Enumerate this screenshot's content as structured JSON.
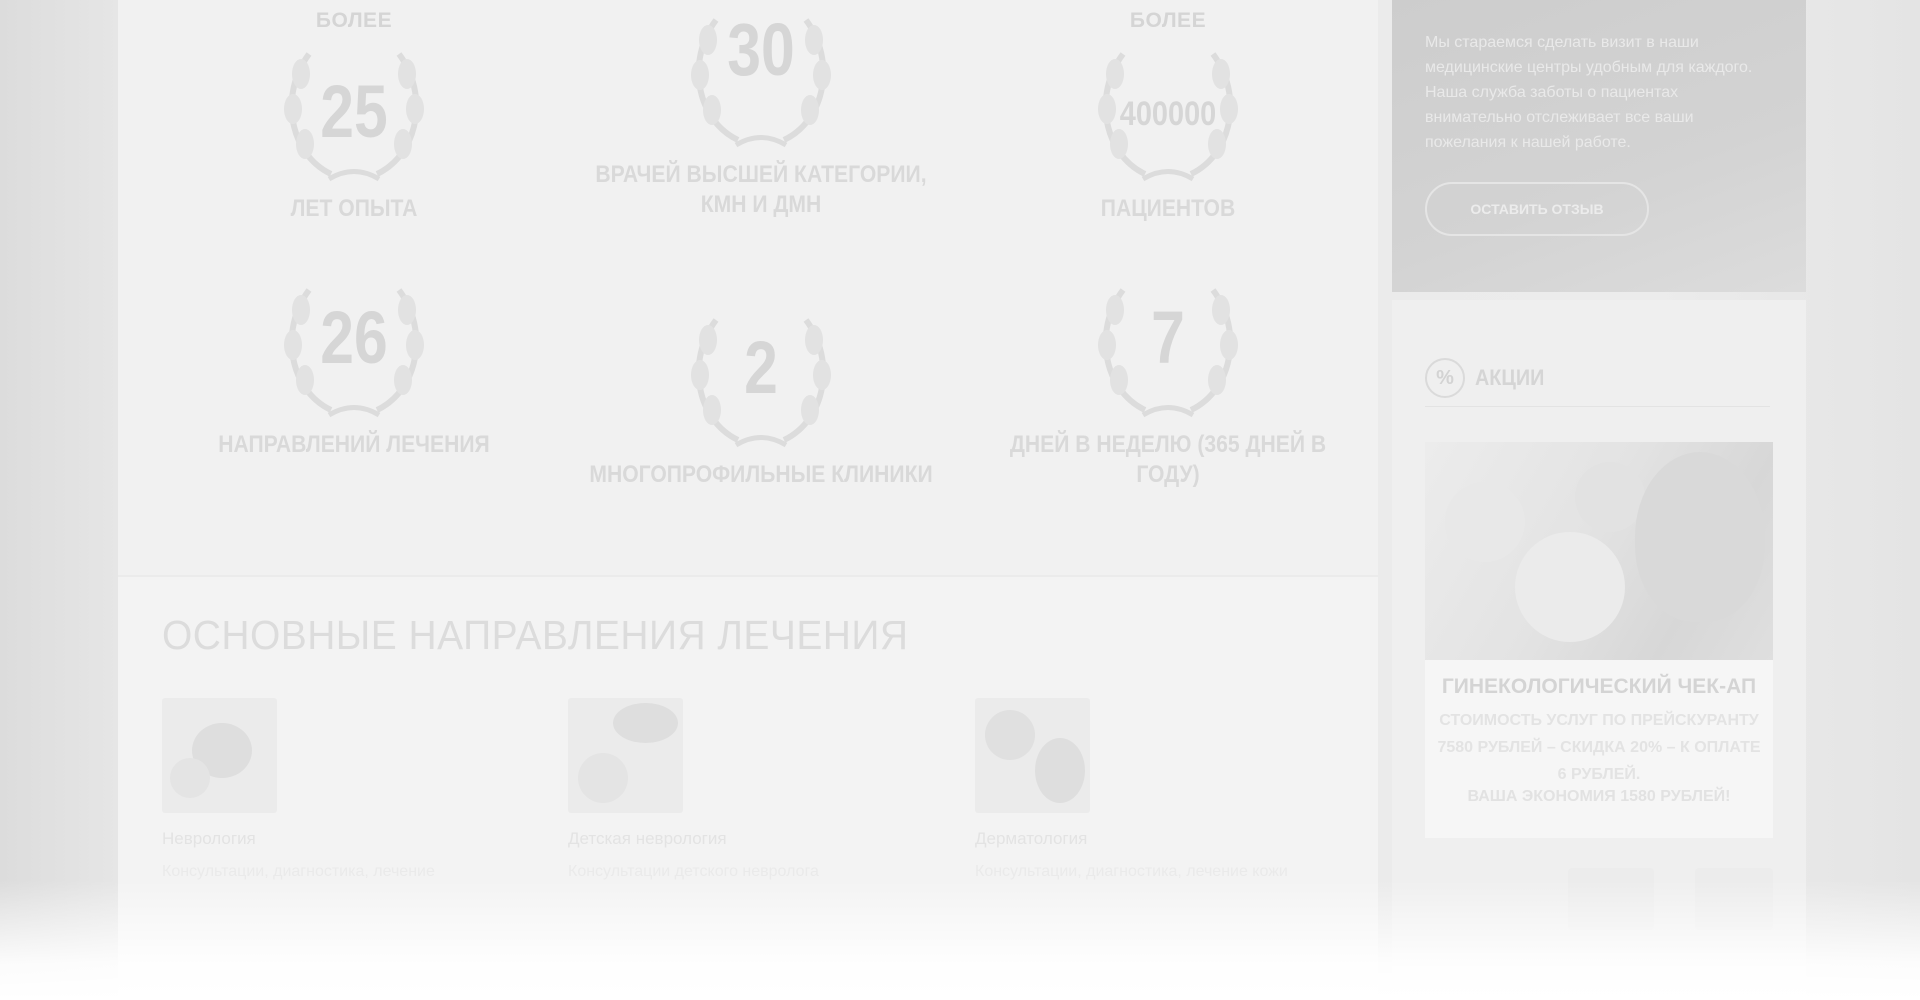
{
  "stats": [
    {
      "prefix": "БОЛЕЕ",
      "number": "25",
      "label": "ЛЕТ ОПЫТА"
    },
    {
      "prefix": "",
      "number": "30",
      "label": "ВРАЧЕЙ ВЫСШЕЙ КАТЕГОРИИ, КМН И ДМН"
    },
    {
      "prefix": "БОЛЕЕ",
      "number": "400000",
      "label": "ПАЦИЕНТОВ"
    },
    {
      "prefix": "",
      "number": "26",
      "label": "НАПРАВЛЕНИЙ ЛЕЧЕНИЯ"
    },
    {
      "prefix": "",
      "number": "2",
      "label": "МНОГОПРОФИЛЬНЫЕ КЛИНИКИ"
    },
    {
      "prefix": "",
      "number": "7",
      "label": "ДНЕЙ В НЕДЕЛЮ (365 ДНЕЙ В ГОДУ)"
    }
  ],
  "directions": {
    "title": "ОСНОВНЫЕ НАПРАВЛЕНИЯ ЛЕЧЕНИЯ",
    "items": [
      {
        "name": "Неврология",
        "desc": "Консультации, диагностика, лечение"
      },
      {
        "name": "Детская неврология",
        "desc": "Консультации детского невролога"
      },
      {
        "name": "Дерматология",
        "desc": "Консультации, диагностика, лечение кожи"
      }
    ]
  },
  "sidebar": {
    "feedback_text": "Мы стараемся сделать визит в наши медицинские центры удобным для каждого. Наша служба заботы о пациентах внимательно отслеживает все ваши пожелания к нашей работе.",
    "feedback_button": "ОСТАВИТЬ ОТЗЫВ",
    "promo_title": "АКЦИИ",
    "promo_icon": "%",
    "promo_card_title": "ГИНЕКОЛОГИЧЕСКИЙ ЧЕК-АП",
    "promo_card_text": "СТОИМОСТЬ УСЛУГ ПО ПРЕЙСКУРАНТУ 7580 РУБЛЕЙ – СКИДКА 20% – К ОПЛАТЕ 6 РУБЛЕЙ.",
    "promo_card_save": "ВАША ЭКОНОМИЯ 1580 РУБЛЕЙ!"
  },
  "colors": {
    "panel": "#f1f1f1",
    "sidebar_dark": "#cdcdcd",
    "text_muted": "#d5d5d5"
  }
}
